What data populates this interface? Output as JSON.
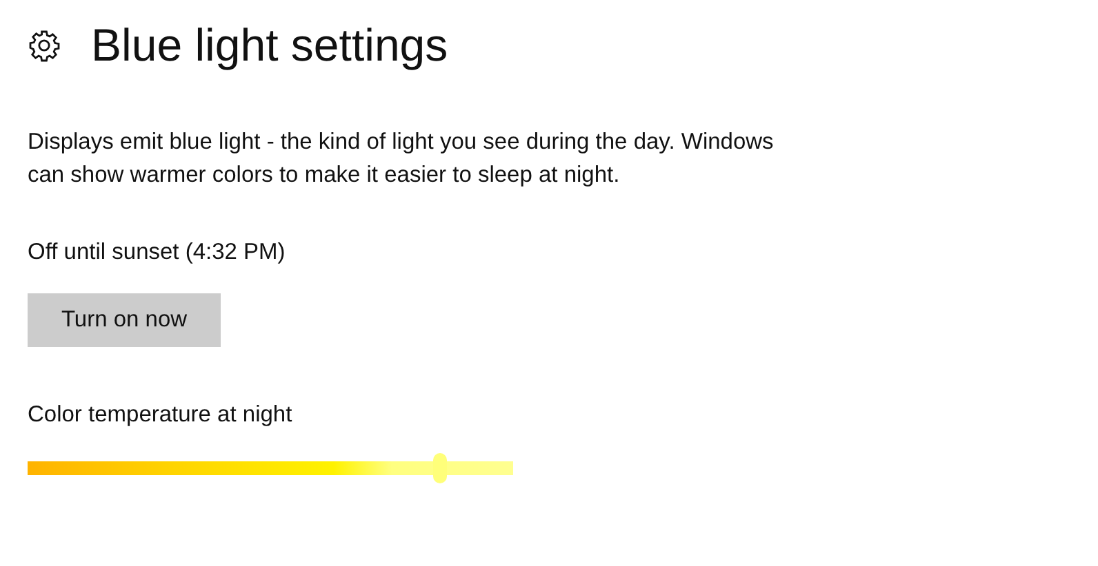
{
  "page": {
    "title": "Blue light settings"
  },
  "description": "Displays emit blue light - the kind of light you see during the day. Windows can show warmer colors to make it easier to sleep at night.",
  "status": "Off until sunset (4:32 PM)",
  "button": {
    "label": "Turn on now"
  },
  "slider": {
    "label": "Color temperature at night",
    "level": 0.85
  }
}
